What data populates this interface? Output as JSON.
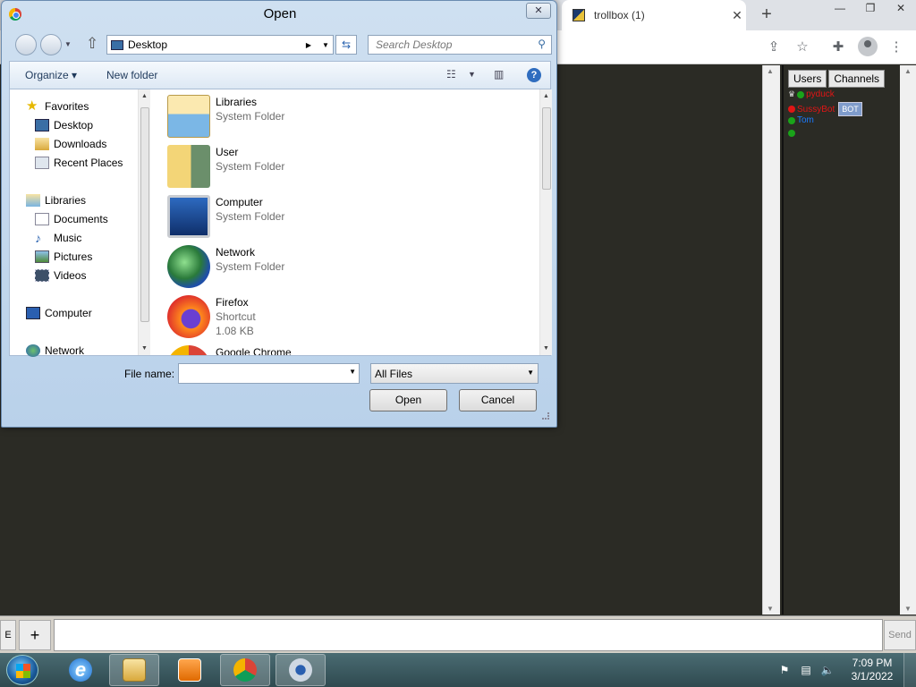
{
  "browser": {
    "tab_title": "trollbox (1)",
    "tab_close": "✕",
    "new_tab": "+",
    "win_min": "—",
    "win_max": "❐",
    "win_close": "✕"
  },
  "trollbox": {
    "panel_tabs": [
      "Users",
      "Channels"
    ],
    "users": [
      {
        "name": "pyduck",
        "color": "#e01515",
        "dot": "#1aa31a",
        "crown": true
      },
      {
        "name": "SussyBot",
        "color": "#e01515",
        "dot": "#e01515",
        "badge": "BOT"
      },
      {
        "name": "Tom",
        "color": "#1a7aff",
        "dot": "#1aa31a"
      },
      {
        "name": "",
        "color": "#1aa31a",
        "dot": "#1aa31a"
      }
    ],
    "e_button": "E",
    "plus_button": "+",
    "send_button": "Send"
  },
  "dialog": {
    "title": "Open",
    "close": "✕",
    "address": "Desktop",
    "search_placeholder": "Search Desktop",
    "organize": "Organize ▾",
    "new_folder": "New folder",
    "help": "?",
    "nav": {
      "favorites": "Favorites",
      "desktop": "Desktop",
      "downloads": "Downloads",
      "recent_places": "Recent Places",
      "libraries": "Libraries",
      "documents": "Documents",
      "music": "Music",
      "pictures": "Pictures",
      "videos": "Videos",
      "computer": "Computer",
      "network": "Network"
    },
    "files": [
      {
        "name": "Libraries",
        "type": "System Folder",
        "size": ""
      },
      {
        "name": "User",
        "type": "System Folder",
        "size": ""
      },
      {
        "name": "Computer",
        "type": "System Folder",
        "size": ""
      },
      {
        "name": "Network",
        "type": "System Folder",
        "size": ""
      },
      {
        "name": "Firefox",
        "type": "Shortcut",
        "size": "1.08 KB"
      },
      {
        "name": "Google Chrome",
        "type": "",
        "size": ""
      }
    ],
    "file_name_label": "File name:",
    "file_name_value": "",
    "filter": "All Files",
    "open_button": "Open",
    "cancel_button": "Cancel"
  },
  "taskbar": {
    "time": "7:09 PM",
    "date": "3/1/2022"
  }
}
